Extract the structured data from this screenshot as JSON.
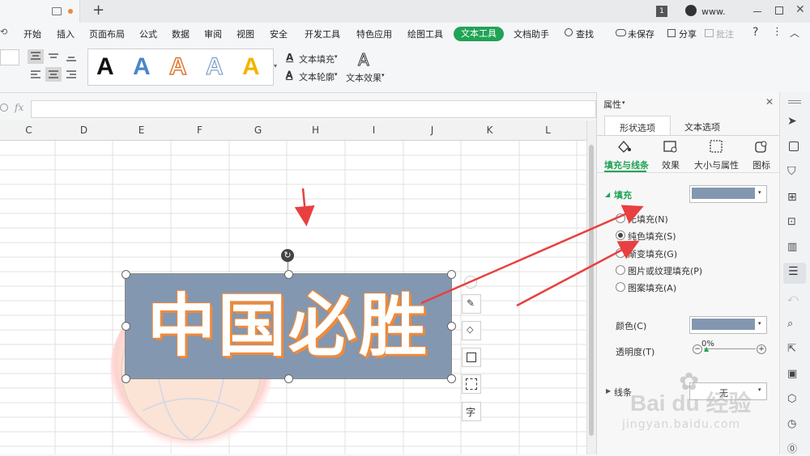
{
  "titlebar": {
    "new_tab": "+",
    "page_badge": "1",
    "account": "www."
  },
  "menu": {
    "items": [
      "开始",
      "插入",
      "页面布局",
      "公式",
      "数据",
      "审阅",
      "视图",
      "安全",
      "开发工具",
      "特色应用",
      "绘图工具",
      "文本工具",
      "文档助手"
    ],
    "active": "文本工具",
    "search": "查找",
    "unsaved": "未保存",
    "share": "分享",
    "comment": "批注"
  },
  "ribbon": {
    "text_fill": "文本填充",
    "text_outline": "文本轮廓",
    "text_effect": "文本效果",
    "style_letter": "A"
  },
  "formula": {
    "fx": "fx",
    "value": ""
  },
  "columns": [
    "C",
    "D",
    "E",
    "F",
    "G",
    "H",
    "I",
    "J",
    "K",
    "L"
  ],
  "textbox": {
    "text": "中国必胜",
    "fill_color": "#8397b0",
    "outline_color": "#f08a3a"
  },
  "panel": {
    "title": "属性",
    "tabs": [
      "形状选项",
      "文本选项"
    ],
    "subtabs": [
      "填充与线条",
      "效果",
      "大小与属性",
      "图标"
    ],
    "fill_section": "填充",
    "fill_options": [
      "无填充(N)",
      "纯色填充(S)",
      "渐变填充(G)",
      "图片或纹理填充(P)",
      "图案填充(A)"
    ],
    "selected_fill": "纯色填充(S)",
    "color_label": "颜色(C)",
    "transparency_label": "透明度(T)",
    "transparency_value": "0%",
    "transparency_fraction": 0,
    "line_section": "线条",
    "line_value": "无"
  },
  "watermark": {
    "brand": "Bai du 经验",
    "url": "jingyan.baidu.com"
  },
  "colors": {
    "accent": "#21a354",
    "arrow": "#e84040",
    "text_fill": "#8397b0"
  }
}
